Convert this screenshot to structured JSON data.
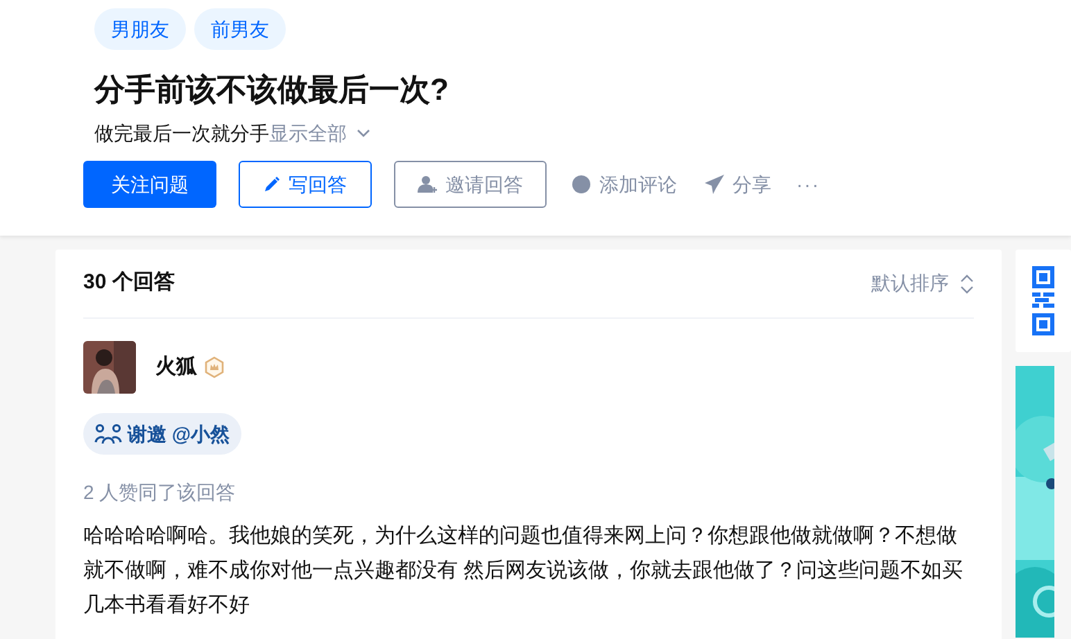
{
  "topics": [
    "男朋友",
    "前男友"
  ],
  "question": {
    "title": "分手前该不该做最后一次?",
    "detail": "做完最后一次就分手",
    "show_all": "显示全部"
  },
  "actions": {
    "follow": "关注问题",
    "write": "写回答",
    "invite": "邀请回答",
    "comment": "添加评论",
    "share": "分享",
    "more": "···"
  },
  "answers": {
    "count": "30 个回答",
    "sort": "默认排序"
  },
  "answer": {
    "author": "火狐",
    "thanks": "谢邀 @小然",
    "votes": "2 人赞同了该回答",
    "content": "哈哈哈哈啊哈。我他娘的笑死，为什么这样的问题也值得来网上问？你想跟他做就做啊？不想做就不做啊，难不成你对他一点兴趣都没有 然后网友说该做，你就去跟他做了？问这些问题不如买几本书看看好不好"
  }
}
